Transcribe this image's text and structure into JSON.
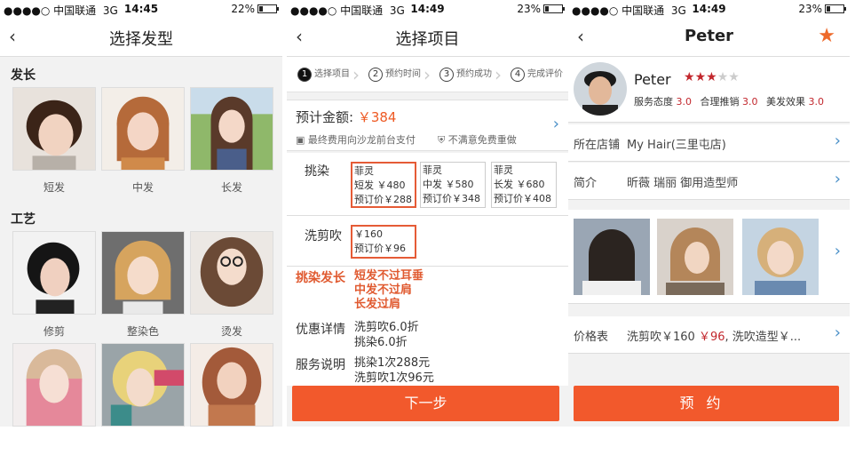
{
  "screens": [
    {
      "status": {
        "carrier": "●●●●○ 中国联通",
        "network": "3G",
        "time": "14:45",
        "battery": "22%",
        "battery_level": 0.22
      },
      "nav": {
        "title": "选择发型"
      },
      "sections": [
        {
          "title": "发长",
          "items": [
            {
              "label": "短发"
            },
            {
              "label": "中发"
            },
            {
              "label": "长发"
            }
          ]
        },
        {
          "title": "工艺",
          "items": [
            {
              "label": "修剪"
            },
            {
              "label": "整染色"
            },
            {
              "label": "烫发"
            }
          ]
        },
        {
          "title": "",
          "items": [
            {
              "label": ""
            },
            {
              "label": ""
            },
            {
              "label": ""
            }
          ]
        }
      ]
    },
    {
      "status": {
        "carrier": "●●●●○ 中国联通",
        "network": "3G",
        "time": "14:49",
        "battery": "23%",
        "battery_level": 0.23
      },
      "nav": {
        "title": "选择项目"
      },
      "steps": [
        {
          "num": "1",
          "label": "选择项目"
        },
        {
          "num": "2",
          "label": "预约时间"
        },
        {
          "num": "3",
          "label": "预约成功"
        },
        {
          "num": "4",
          "label": "完成评价"
        }
      ],
      "estimate": {
        "label": "预计金额:",
        "amount": "￥384",
        "note_pay": "最终费用向沙龙前台支付",
        "note_refund": "不满意免费重做"
      },
      "dye": {
        "label": "挑染",
        "options": [
          {
            "name": "菲灵",
            "desc": "短发 ￥480",
            "price": "预订价￥288"
          },
          {
            "name": "菲灵",
            "desc": "中发 ￥580",
            "price": "预订价￥348"
          },
          {
            "name": "菲灵",
            "desc": "长发 ￥680",
            "price": "预订价￥408"
          }
        ]
      },
      "cut": {
        "label": "洗剪吹",
        "option": {
          "price": "￥160",
          "book": "预订价￥96"
        }
      },
      "dye_length": {
        "label": "挑染发长",
        "lines": [
          "短发不过耳垂",
          "中发不过肩",
          "长发过肩"
        ]
      },
      "discount": {
        "label": "优惠详情",
        "lines": [
          "洗剪吹6.0折",
          "挑染6.0折"
        ]
      },
      "service": {
        "label": "服务说明",
        "lines": [
          "挑染1次288元",
          "洗剪吹1次96元"
        ]
      },
      "next_label": "下一步"
    },
    {
      "status": {
        "carrier": "●●●●○ 中国联通",
        "network": "3G",
        "time": "14:49",
        "battery": "23%",
        "battery_level": 0.23
      },
      "nav": {
        "title": "Peter"
      },
      "profile": {
        "name": "Peter",
        "rating": 3,
        "rating_max": 5,
        "scores": [
          {
            "label": "服务态度",
            "value": "3.0"
          },
          {
            "label": "合理推销",
            "value": "3.0"
          },
          {
            "label": "美发效果",
            "value": "3.0"
          }
        ]
      },
      "store": {
        "label": "所在店铺",
        "value": "My Hair(三里屯店)"
      },
      "intro": {
        "label": "简介",
        "value": "昕薇 瑞丽 御用造型师"
      },
      "price": {
        "label": "价格表",
        "value_prefix": "洗剪吹￥160 ",
        "value_red": "￥96",
        "value_suffix": ", 洗吹造型￥..."
      },
      "book_label": "预约"
    }
  ]
}
